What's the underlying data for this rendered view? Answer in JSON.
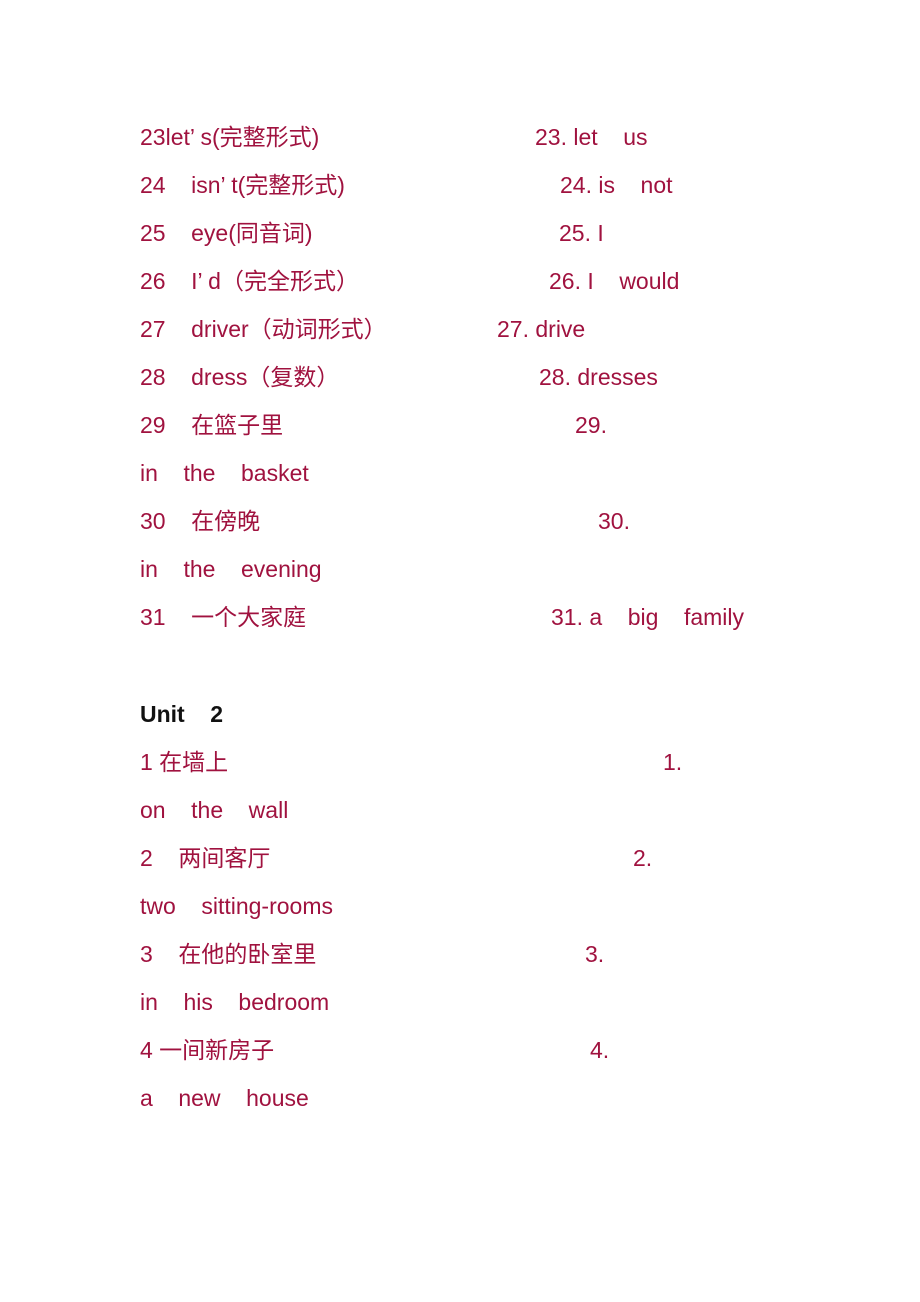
{
  "text_color": "#A0123F",
  "heading_color": "#111111",
  "unit1_items": [
    {
      "prompt": "23let’ s(完整形式)",
      "answer": "23. let    us"
    },
    {
      "prompt": "24    isn’ t(完整形式)",
      "answer": "24. is    not"
    },
    {
      "prompt": "25    eye(同音词)",
      "answer": "25. I"
    },
    {
      "prompt": "26    I’ d（完全形式）",
      "answer": "26. I    would"
    },
    {
      "prompt": "27    driver（动词形式）",
      "answer": "27. drive"
    },
    {
      "prompt": "28    dress（复数）",
      "answer": "28. dresses"
    },
    {
      "prompt": "29    在篮子里",
      "answer": "29.",
      "continuation": "in    the    basket"
    },
    {
      "prompt": "30    在傍晚",
      "answer": "30.",
      "continuation": "in    the    evening"
    },
    {
      "prompt": "31    一个大家庭",
      "answer": "31. a    big    family"
    }
  ],
  "unit2": {
    "heading": "Unit    2",
    "items": [
      {
        "prompt": "1 在墙上",
        "answer": "1.",
        "continuation": "on    the    wall"
      },
      {
        "prompt": "2    两间客厅",
        "answer": "2.",
        "continuation": "two    sitting-rooms"
      },
      {
        "prompt": "3    在他的卧室里",
        "answer": "3.",
        "continuation": "in    his    bedroom"
      },
      {
        "prompt": "4 一间新房子",
        "answer": "4.",
        "continuation": "a    new    house"
      }
    ]
  }
}
